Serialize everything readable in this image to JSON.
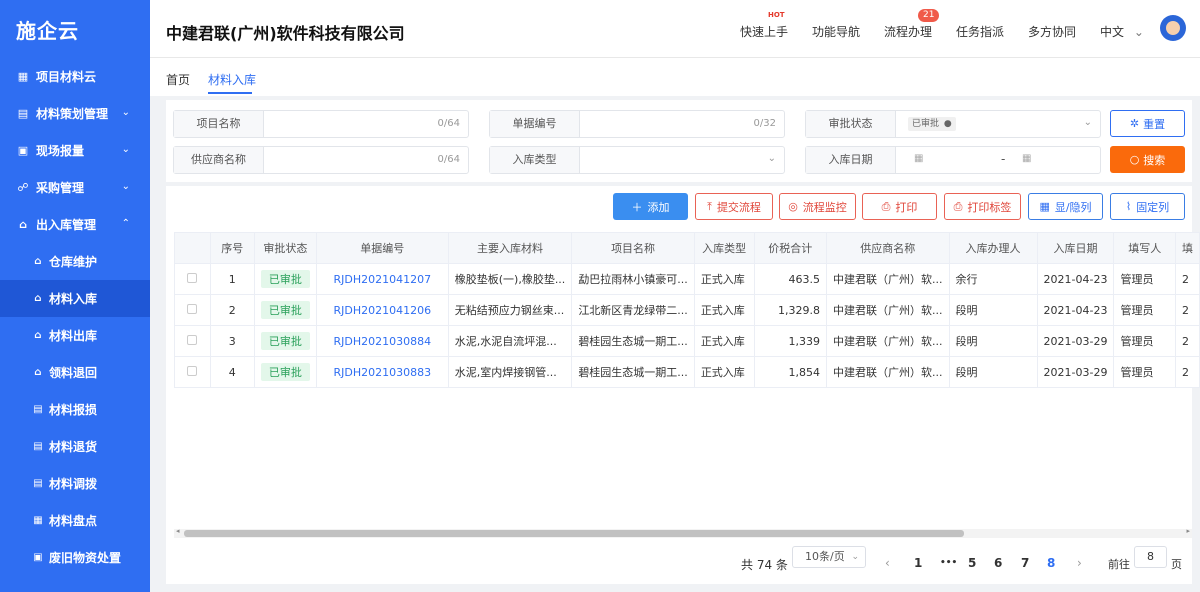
{
  "logo": "施企云",
  "company": "中建君联(广州)软件科技有限公司",
  "header_nav": [
    {
      "label": "快速上手",
      "hot": "HOT"
    },
    {
      "label": "功能导航"
    },
    {
      "label": "流程办理",
      "badge": "21"
    },
    {
      "label": "任务指派"
    },
    {
      "label": "多方协同"
    },
    {
      "label": "中文"
    }
  ],
  "sidebar": {
    "items": [
      {
        "label": "项目材料云"
      },
      {
        "label": "材料策划管理"
      },
      {
        "label": "现场报量"
      },
      {
        "label": "采购管理"
      },
      {
        "label": "出入库管理"
      }
    ],
    "subitems": [
      {
        "label": "仓库维护"
      },
      {
        "label": "材料入库"
      },
      {
        "label": "材料出库"
      },
      {
        "label": "领料退回"
      },
      {
        "label": "材料报损"
      },
      {
        "label": "材料退货"
      },
      {
        "label": "材料调拨"
      },
      {
        "label": "材料盘点"
      },
      {
        "label": "废旧物资处置"
      }
    ]
  },
  "breadcrumbs": [
    "首页",
    "材料入库"
  ],
  "filters": {
    "project_name": {
      "label": "项目名称",
      "count": "0/64"
    },
    "bill_no": {
      "label": "单据编号",
      "count": "0/32"
    },
    "approval_status": {
      "label": "审批状态",
      "tag": "已审批"
    },
    "supplier": {
      "label": "供应商名称",
      "count": "0/64"
    },
    "in_type": {
      "label": "入库类型"
    },
    "in_date": {
      "label": "入库日期",
      "separator": "-"
    },
    "reset": "重置",
    "search": "搜索"
  },
  "toolbar": {
    "add": "添加",
    "submit_flow": "提交流程",
    "flow_monitor": "流程监控",
    "print": "打印",
    "print_label": "打印标签",
    "show_hide_cols": "显/隐列",
    "fixed_cols": "固定列"
  },
  "table": {
    "headers": [
      "序号",
      "审批状态",
      "单据编号",
      "主要入库材料",
      "项目名称",
      "入库类型",
      "价税合计",
      "供应商名称",
      "入库办理人",
      "入库日期",
      "填写人",
      "填"
    ],
    "rows": [
      {
        "no": "1",
        "status": "已审批",
        "bill": "RJDH2021041207",
        "material": "橡胶垫板(一),橡胶垫...",
        "project": "勐巴拉雨林小镇豪可...",
        "type": "正式入库",
        "amount": "463.5",
        "supplier": "中建君联（广州）软...",
        "handler": "余行",
        "date": "2021-04-23",
        "writer": "管理员",
        "extra": "2"
      },
      {
        "no": "2",
        "status": "已审批",
        "bill": "RJDH2021041206",
        "material": "无粘结预应力钢丝束...",
        "project": "江北新区青龙绿带二...",
        "type": "正式入库",
        "amount": "1,329.8",
        "supplier": "中建君联（广州）软...",
        "handler": "段明",
        "date": "2021-04-23",
        "writer": "管理员",
        "extra": "2"
      },
      {
        "no": "3",
        "status": "已审批",
        "bill": "RJDH2021030884",
        "material": "水泥,水泥自流坪混...",
        "project": "碧桂园生态城一期工...",
        "type": "正式入库",
        "amount": "1,339",
        "supplier": "中建君联（广州）软...",
        "handler": "段明",
        "date": "2021-03-29",
        "writer": "管理员",
        "extra": "2"
      },
      {
        "no": "4",
        "status": "已审批",
        "bill": "RJDH2021030883",
        "material": "水泥,室内焊接钢管...",
        "project": "碧桂园生态城一期工...",
        "type": "正式入库",
        "amount": "1,854",
        "supplier": "中建君联（广州）软...",
        "handler": "段明",
        "date": "2021-03-29",
        "writer": "管理员",
        "extra": "2"
      }
    ]
  },
  "pagination": {
    "total": "共 74 条",
    "page_size": "10条/页",
    "prev": "‹",
    "pages": [
      "1",
      "•••",
      "5",
      "6",
      "7",
      "8"
    ],
    "active_page": "8",
    "next": "›",
    "goto_label": "前往",
    "goto_value": "8",
    "goto_suffix": "页"
  },
  "colors": {
    "primary": "#2f6ef2",
    "orange": "#fa6a0c",
    "red": "#e0463a",
    "success_bg": "#e3f7ea",
    "success_text": "#2ba15b"
  }
}
